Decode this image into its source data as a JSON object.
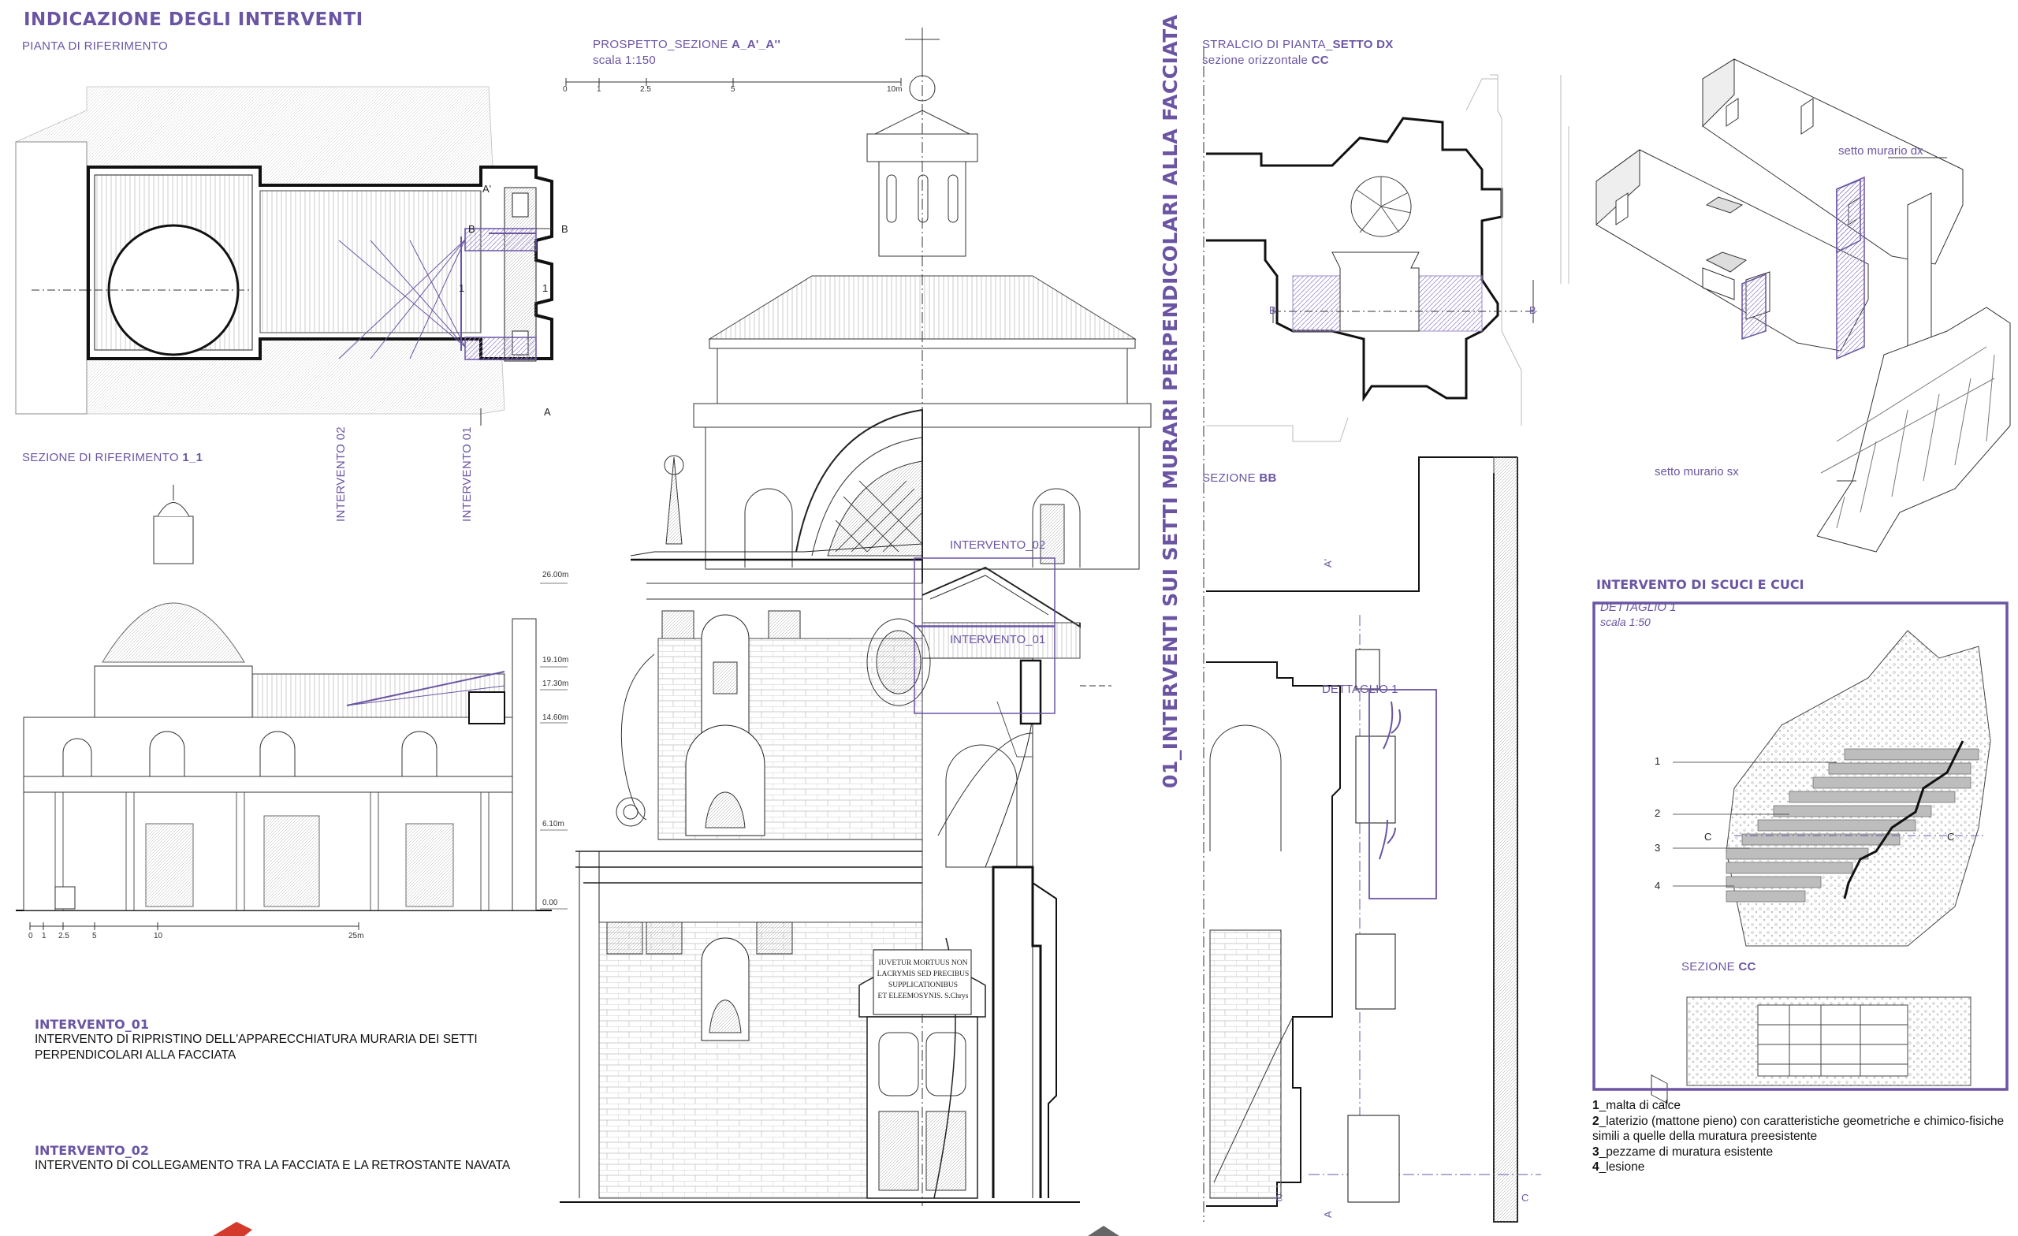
{
  "header": {
    "title": "INDICAZIONE DEGLI INTERVENTI",
    "pianta_label": "PIANTA DI RIFERIMENTO"
  },
  "sezione_riferimento": {
    "label": "SEZIONE DI RIFERIMENTO",
    "code": "1_1",
    "levels": [
      "26.00m",
      "19.10m",
      "17.30m",
      "14.60m",
      "6.10m",
      "0.00"
    ],
    "scale_ticks": [
      "0",
      "1",
      "2.5",
      "5",
      "10",
      "25m"
    ]
  },
  "plan_markers": {
    "intervento_02": "INTERVENTO 02",
    "intervento_01": "INTERVENTO 01",
    "a": "A",
    "a1": "A'",
    "b": "B",
    "one": "1"
  },
  "prospetto": {
    "label": "PROSPETTO_SEZIONE",
    "code": "A_A'_A''",
    "scale": "scala 1:150",
    "scale_ticks": [
      "0",
      "1",
      "2.5",
      "5",
      "10m"
    ],
    "intervento_02": "INTERVENTO_02",
    "intervento_01": "INTERVENTO_01",
    "inscription": [
      "IUVETUR MORTUUS NON",
      "LACRYMIS SED PRECIBUS",
      "SUPPLICATIONIBUS",
      "ET ELEEMOSYNIS. S.Chrys"
    ]
  },
  "central_title": "01_INTERVENTI SUI SETTI MURARI PERPENDICOLARI ALLA FACCIATA",
  "stralcio": {
    "label": "STRALCIO DI PIANTA_",
    "code": "SETTO DX",
    "sub": "sezione orizzontale",
    "sub_code": "CC",
    "b": "B"
  },
  "sezione_bb": {
    "label": "SEZIONE",
    "code": "BB",
    "dettaglio": "DETTAGLIO 1",
    "a1": "A'",
    "a": "A",
    "c": "C"
  },
  "axon": {
    "dx": "setto murario dx",
    "sx": "setto murario sx"
  },
  "scuci": {
    "title": "INTERVENTO DI SCUCI E CUCI",
    "dettaglio": "DETTAGLIO 1",
    "scale": "scala 1:50",
    "nums": [
      "1",
      "2",
      "3",
      "4"
    ],
    "c": "C",
    "sezione": "SEZIONE",
    "sezione_code": "CC"
  },
  "legend": [
    {
      "n": "1",
      "t": "_malta di calce"
    },
    {
      "n": "2",
      "t": "_laterizio (mattone pieno) con caratteristiche geometriche e chimico-fisiche simili a quelle della muratura preesistente"
    },
    {
      "n": "3",
      "t": "_pezzame di muratura esistente"
    },
    {
      "n": "4",
      "t": "_lesione"
    }
  ],
  "interventi": [
    {
      "head": "INTERVENTO_01",
      "text": "INTERVENTO DI RIPRISTINO DELL'APPARECCHIATURA MURARIA DEI SETTI PERPENDICOLARI ALLA FACCIATA"
    },
    {
      "head": "INTERVENTO_02",
      "text": "INTERVENTO DI COLLEGAMENTO TRA LA FACCIATA E LA RETROSTANTE NAVATA"
    }
  ],
  "colors": {
    "accent": "#6b55a3",
    "hatch": "#b9a9dc",
    "line": "#2a2a2a"
  }
}
